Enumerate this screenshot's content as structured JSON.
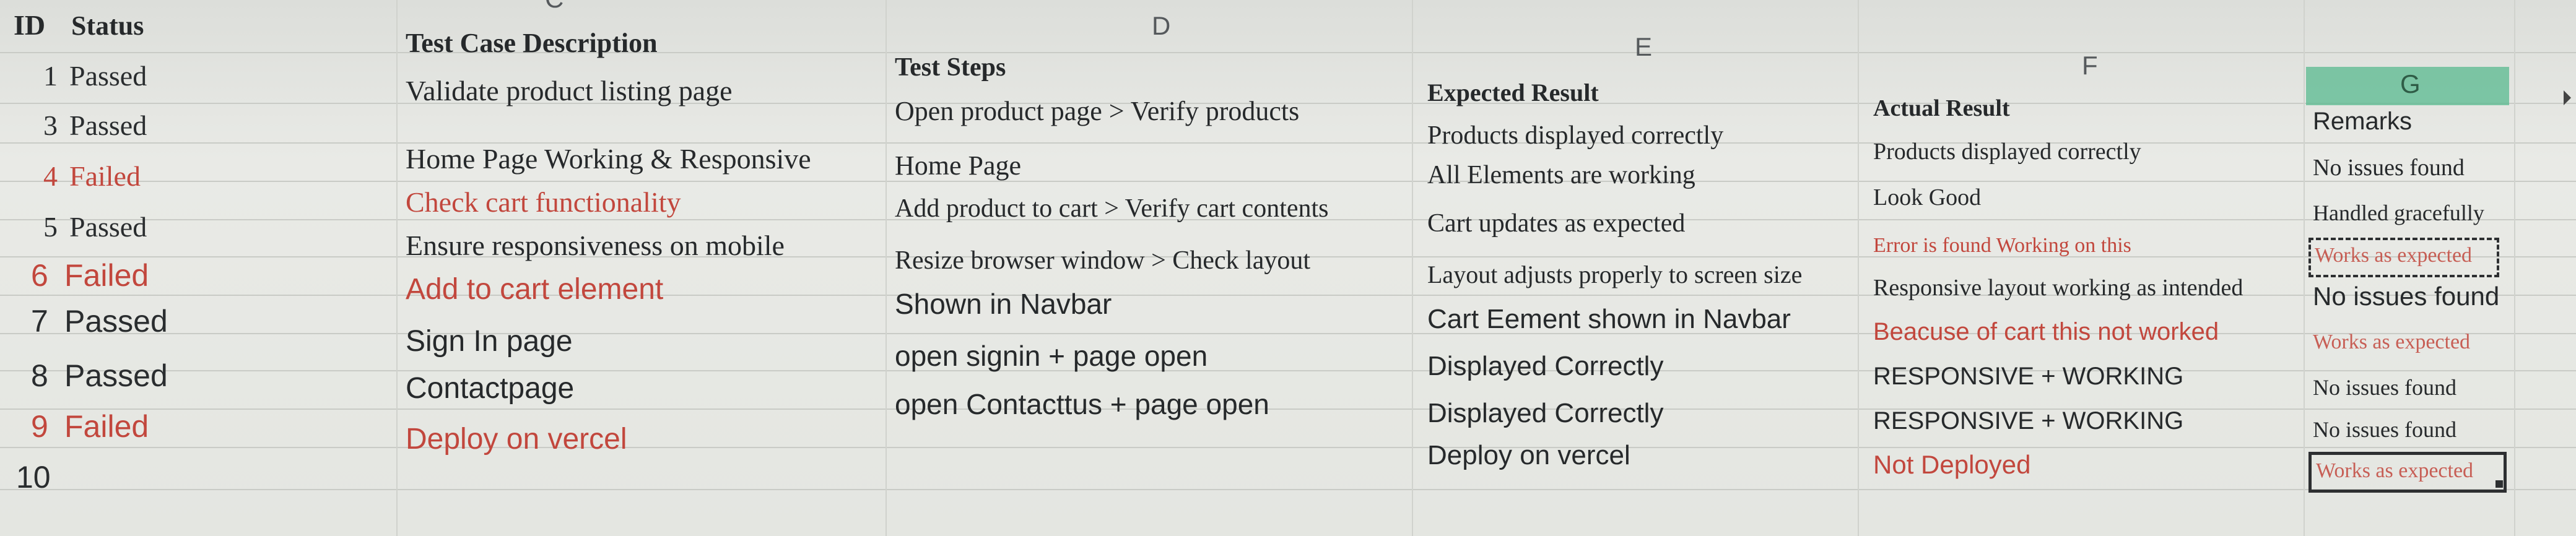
{
  "columns": {
    "c": "C",
    "d": "D",
    "e": "E",
    "f": "F",
    "g": "G"
  },
  "headers": {
    "id": "ID",
    "status": "Status",
    "desc": "Test Case Description",
    "steps": "Test Steps",
    "expected": "Expected Result",
    "actual": "Actual Result",
    "remarks": "Remarks"
  },
  "rows": [
    {
      "id": "1",
      "status": "Passed",
      "desc": "Validate product listing page",
      "steps": "Open product page > Verify products",
      "expected": "Products displayed correctly",
      "actual": "Products displayed correctly",
      "remarks": "No issues found"
    },
    {
      "id": "3",
      "status": "Passed",
      "desc": "Home Page Working & Responsive",
      "steps": "Home Page",
      "expected": "All Elements are working",
      "actual": "Look Good",
      "remarks": "Handled gracefully"
    },
    {
      "id": "4",
      "status": "Failed",
      "desc": "Check cart functionality",
      "steps": "Add product to cart > Verify cart contents",
      "expected": "Cart updates as expected",
      "actual": "Error is found Working on this",
      "remarks": "Works as expected"
    },
    {
      "id": "5",
      "status": "Passed",
      "desc": "Ensure responsiveness on mobile",
      "steps": "Resize browser window > Check layout",
      "expected": "Layout adjusts properly to screen size",
      "actual": "Responsive layout working as intended",
      "remarks": "No issues found"
    },
    {
      "id": "6",
      "status": "Failed",
      "desc": "Add to cart element",
      "steps": "Shown in Navbar",
      "expected": "Cart Eement shown in Navbar",
      "actual": "Beacuse of cart this not worked",
      "remarks": "Works as expected"
    },
    {
      "id": "7",
      "status": "Passed",
      "desc": "Sign In page",
      "steps": "open signin + page open",
      "expected": "Displayed Correctly",
      "actual": "RESPONSIVE + WORKING",
      "remarks": "No issues found"
    },
    {
      "id": "8",
      "status": "Passed",
      "desc": "Contactpage",
      "steps": "open Contacttus + page open",
      "expected": "Displayed Correctly",
      "actual": "RESPONSIVE + WORKING",
      "remarks": "No issues found"
    },
    {
      "id": "9",
      "status": "Failed",
      "desc": "Deploy on vercel",
      "steps": "",
      "expected": "Deploy on vercel",
      "actual": "Not Deployed",
      "remarks": "Works as expected"
    },
    {
      "id": "10",
      "status": "",
      "desc": "",
      "steps": "",
      "expected": "",
      "actual": "",
      "remarks": ""
    }
  ],
  "colors": {
    "failed": "#c2473d",
    "header_fill": "#58b98f"
  }
}
